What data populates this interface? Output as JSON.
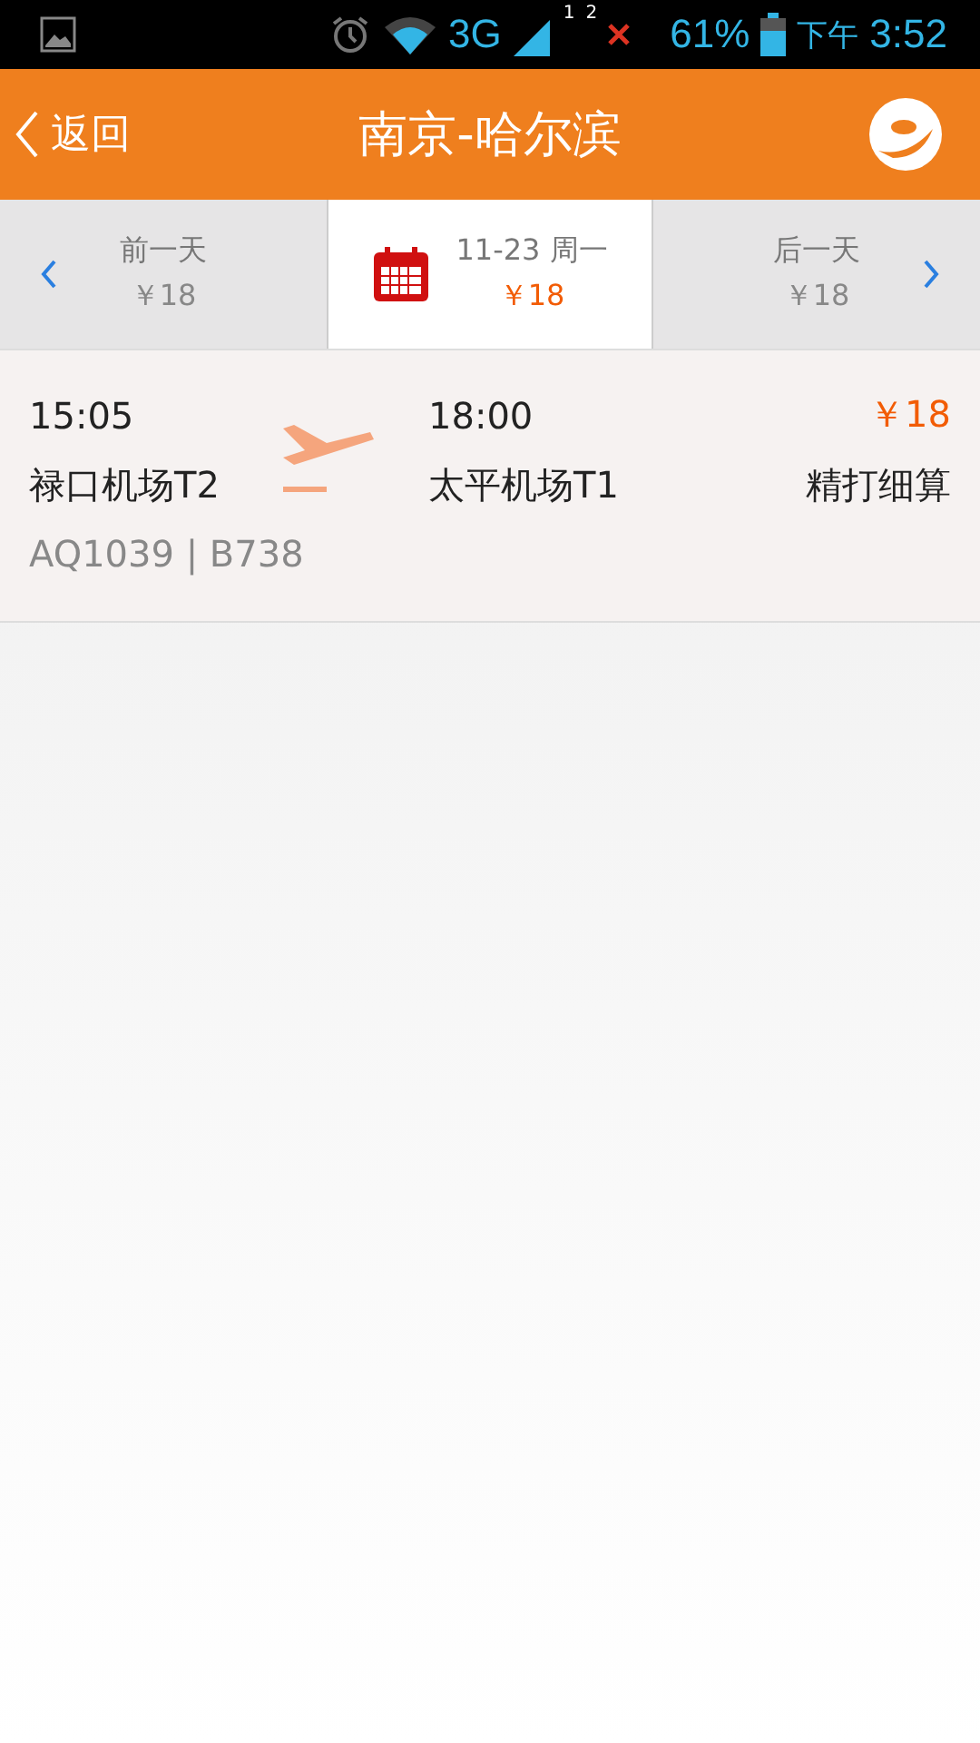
{
  "status_bar": {
    "network": "3G",
    "sim_1": "1",
    "sim_2": "2",
    "battery": "61%",
    "period": "下午",
    "time": "3:52"
  },
  "header": {
    "back": "返回",
    "title": "南京-哈尔滨"
  },
  "date_tabs": [
    {
      "kind": "prev",
      "label": "前一天",
      "price": "￥18",
      "selected": false
    },
    {
      "kind": "current",
      "label": "11-23 周一",
      "price": "￥18",
      "selected": true
    },
    {
      "kind": "next",
      "label": "后一天",
      "price": "￥18",
      "selected": false
    }
  ],
  "flights": [
    {
      "depart_time": "15:05",
      "depart_airport": "禄口机场T2",
      "arrive_time": "18:00",
      "arrive_airport": "太平机场T1",
      "price": "￥18",
      "fare_type": "精打细算",
      "flight_info": "AQ1039 | B738"
    }
  ]
}
